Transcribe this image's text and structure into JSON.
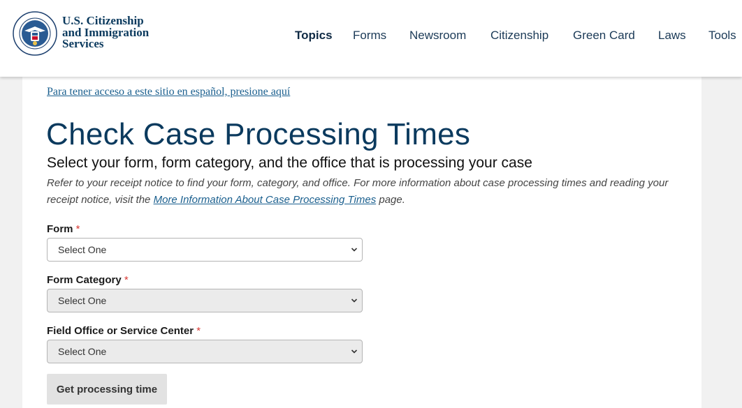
{
  "header": {
    "seal_text": "U.S. DEPARTMENT OF HOMELAND SECURITY",
    "agency_lines": [
      "U.S. Citizenship",
      "and Immigration",
      "Services"
    ],
    "nav": [
      {
        "label": "Topics",
        "active": true
      },
      {
        "label": "Forms",
        "active": false
      },
      {
        "label": "Newsroom",
        "active": false
      },
      {
        "label": "Citizenship",
        "active": false
      },
      {
        "label": "Green Card",
        "active": false
      },
      {
        "label": "Laws",
        "active": false
      },
      {
        "label": "Tools",
        "active": false
      }
    ]
  },
  "main": {
    "spanish_link": "Para tener acceso a este sitio en español, presione aquí",
    "title": "Check Case Processing Times",
    "subtitle": "Select your form, form category, and the office that is processing your case",
    "intro_before": "Refer to your receipt notice to find your form, category, and office. For more information about case processing times and reading your receipt notice, visit the ",
    "intro_link": "More Information About Case Processing Times",
    "intro_after": " page.",
    "fields": [
      {
        "label": "Form",
        "required_mark": "*",
        "selected": "Select One",
        "disabled": false
      },
      {
        "label": "Form Category",
        "required_mark": "*",
        "selected": "Select One",
        "disabled": true
      },
      {
        "label": "Field Office or Service Center",
        "required_mark": "*",
        "selected": "Select One",
        "disabled": true
      }
    ],
    "submit_label": "Get processing time"
  },
  "colors": {
    "brand_navy": "#0b3a5e",
    "link": "#1a5f8e",
    "required": "#d83933",
    "page_bg": "#f1f1f1"
  },
  "icons": {
    "seal": "dhs-seal-icon",
    "select_arrow": "chevron-down-icon"
  }
}
